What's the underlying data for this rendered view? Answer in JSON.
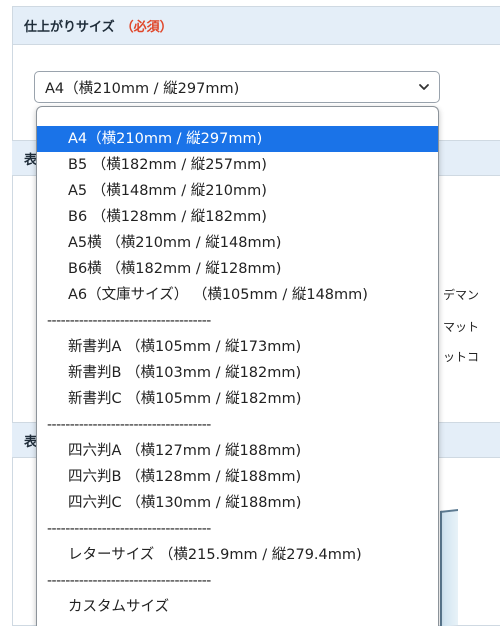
{
  "panel": {
    "title": "仕上がりサイズ",
    "required": "（必須）",
    "section2_prefix": "表",
    "section3_prefix": "表"
  },
  "select": {
    "value": "A4（横210mm / 縦297mm)"
  },
  "background_text": {
    "line1": "デマン",
    "line2": "マット",
    "line3": "ットコ"
  },
  "options": [
    {
      "type": "opt",
      "label": "A4（横210mm / 縦297mm)",
      "selected": true
    },
    {
      "type": "opt",
      "label": "B5 （横182mm / 縦257mm)"
    },
    {
      "type": "opt",
      "label": "A5 （横148mm / 縦210mm)"
    },
    {
      "type": "opt",
      "label": "B6 （横128mm / 縦182mm)"
    },
    {
      "type": "opt",
      "label": "A5横 （横210mm / 縦148mm)"
    },
    {
      "type": "opt",
      "label": "B6横 （横182mm / 縦128mm)"
    },
    {
      "type": "opt",
      "label": "A6（文庫サイズ） （横105mm / 縦148mm)"
    },
    {
      "type": "sep",
      "label": "------------------------------------"
    },
    {
      "type": "opt",
      "label": "新書判A （横105mm / 縦173mm)"
    },
    {
      "type": "opt",
      "label": "新書判B （横103mm / 縦182mm)"
    },
    {
      "type": "opt",
      "label": "新書判C （横105mm / 縦182mm)"
    },
    {
      "type": "sep",
      "label": "------------------------------------"
    },
    {
      "type": "opt",
      "label": "四六判A （横127mm / 縦188mm)"
    },
    {
      "type": "opt",
      "label": "四六判B （横128mm / 縦188mm)"
    },
    {
      "type": "opt",
      "label": "四六判C （横130mm / 縦188mm)"
    },
    {
      "type": "sep",
      "label": "------------------------------------"
    },
    {
      "type": "opt",
      "label": "レターサイズ （横215.9mm / 縦279.4mm)"
    },
    {
      "type": "sep",
      "label": "------------------------------------"
    },
    {
      "type": "opt",
      "label": "カスタムサイズ"
    }
  ],
  "colors": {
    "accent": "#1a73e8",
    "required": "#e0462a",
    "header_bg": "#e4eef8"
  },
  "icons": {
    "select_chevron": "chevron-down-icon"
  }
}
